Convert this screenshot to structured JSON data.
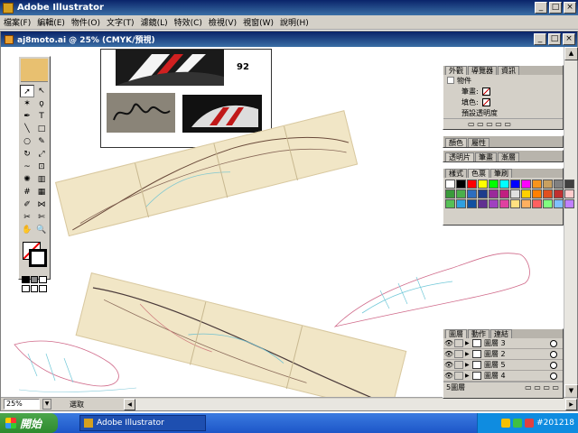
{
  "app": {
    "title": "Adobe Illustrator"
  },
  "menu": [
    "檔案(F)",
    "編輯(E)",
    "物件(O)",
    "文字(T)",
    "濾鏡(L)",
    "特效(C)",
    "檢視(V)",
    "視窗(W)",
    "說明(H)"
  ],
  "document": {
    "title": "aj8moto.ai @ 25% (CMYK/預視)"
  },
  "artboard": {
    "page_number": "92"
  },
  "status": {
    "zoom": "25%",
    "tool": "選取"
  },
  "palettes": {
    "appearance": {
      "tabs": [
        "外觀",
        "導覽器",
        "資訊"
      ],
      "object_label": "物件",
      "stroke_label": "筆畫:",
      "fill_label": "填色:",
      "opacity_label": "預設透明度"
    },
    "color": {
      "tabs": [
        "顏色",
        "屬性"
      ]
    },
    "transparency": {
      "tabs": [
        "透明片",
        "筆畫",
        "漸層"
      ]
    },
    "swatches": {
      "tabs": [
        "樣式",
        "色票",
        "筆刷"
      ],
      "colors": [
        "#ffffff",
        "#000000",
        "#ff0000",
        "#ffff00",
        "#00ff00",
        "#00ffff",
        "#0000ff",
        "#ff00ff",
        "#f7941d",
        "#c8a060",
        "#808080",
        "#404040",
        "#3a9a3a",
        "#4ab04a",
        "#2d6ec0",
        "#1d3c8c",
        "#9a2a9a",
        "#c02080",
        "#e0e0e0",
        "#ffd000",
        "#ff8000",
        "#e05020",
        "#c03030",
        "#ffcccc",
        "#56c056",
        "#30a0e0",
        "#1050a0",
        "#603090",
        "#a040c0",
        "#e040a0",
        "#ffe080",
        "#ffb060",
        "#ff6060",
        "#80ff80",
        "#80c0ff",
        "#c080ff"
      ]
    },
    "layers": {
      "tabs": [
        "圖層",
        "動作",
        "連結"
      ],
      "items": [
        {
          "name": "圖層 3"
        },
        {
          "name": "圖層 2"
        },
        {
          "name": "圖層 5"
        },
        {
          "name": "圖層 4"
        }
      ],
      "footer": "5圖層"
    }
  },
  "taskbar": {
    "start_label": "開始",
    "active_task": "Adobe Illustrator",
    "tray_text": "#201218"
  }
}
